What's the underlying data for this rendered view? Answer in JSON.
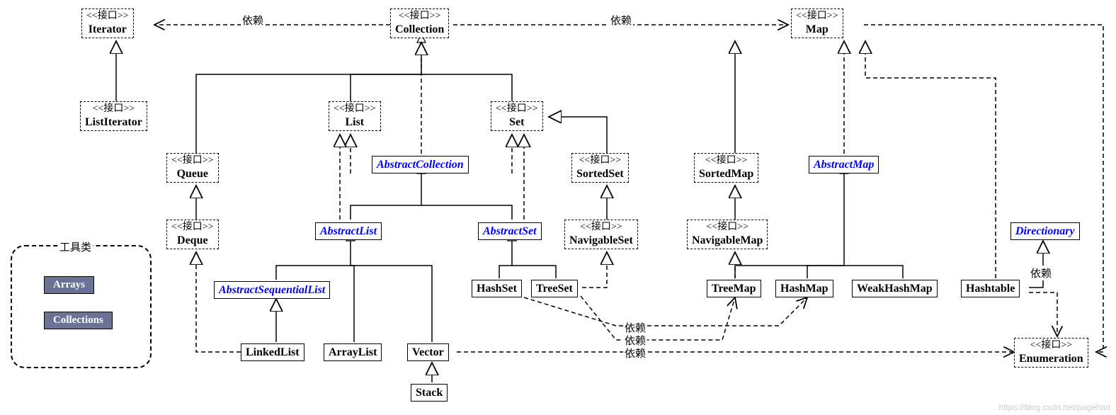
{
  "stereo": "<<接口>>",
  "labels": {
    "dep": "依赖",
    "util": "工具类"
  },
  "nodes": {
    "iterator": "Iterator",
    "collection": "Collection",
    "map": "Map",
    "listiterator": "ListIterator",
    "list": "List",
    "set": "Set",
    "queue": "Queue",
    "sortedset": "SortedSet",
    "sortedmap": "SortedMap",
    "deque": "Deque",
    "navigableset": "NavigableSet",
    "navigablemap": "NavigableMap",
    "abstractcollection": "AbstractCollection",
    "abstractlist": "AbstractList",
    "abstractset": "AbstractSet",
    "abstractmap": "AbstractMap",
    "abstractsequentiallist": "AbstractSequentialList",
    "hashset": "HashSet",
    "treeset": "TreeSet",
    "treemap": "TreeMap",
    "hashmap": "HashMap",
    "weakhashmap": "WeakHashMap",
    "hashtable": "Hashtable",
    "directionary": "Directionary",
    "linkedlist": "LinkedList",
    "arraylist": "ArrayList",
    "vector": "Vector",
    "stack": "Stack",
    "enumeration": "Enumeration",
    "arrays": "Arrays",
    "collections": "Collections"
  },
  "watermark": "https://blog.csdn.net/pagehao"
}
